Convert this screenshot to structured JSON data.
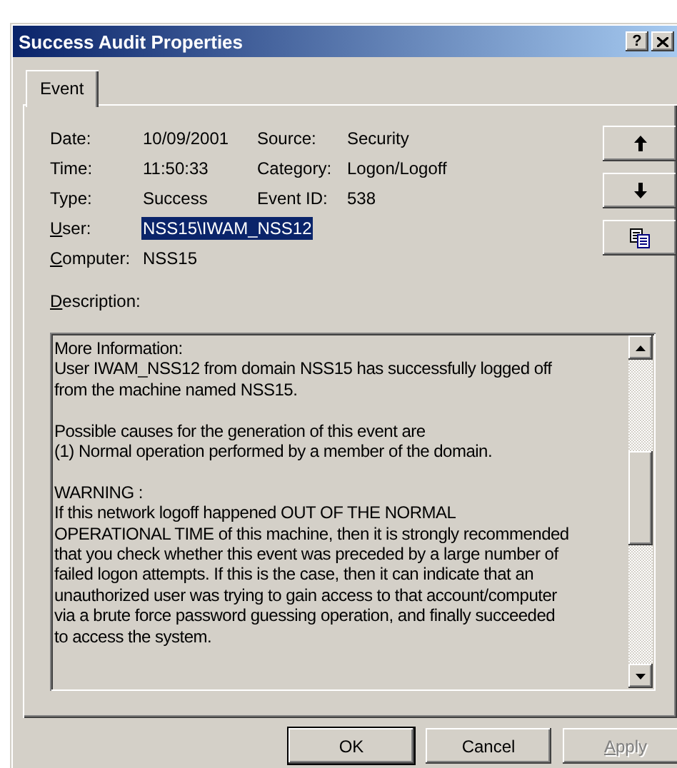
{
  "window": {
    "title": "Success Audit Properties",
    "title_buttons": [
      {
        "kind": "help",
        "label": "?"
      },
      {
        "kind": "close"
      }
    ]
  },
  "tabs": [
    {
      "label": "Event",
      "selected": true
    }
  ],
  "fields": [
    [
      {
        "label": "Date:",
        "value": "10/09/2001"
      },
      {
        "label": "Source:",
        "value": "Security"
      }
    ],
    [
      {
        "label": "Time:",
        "value": "11:50:33"
      },
      {
        "label": "Category:",
        "value": "Logon/Logoff"
      }
    ],
    [
      {
        "label": "Type:",
        "value": "Success"
      },
      {
        "label": "Event ID:",
        "value": "538"
      }
    ],
    [
      {
        "label": "User:",
        "mnemonic": true,
        "value": "NSS15\\IWAM_NSS12",
        "selected": true
      }
    ],
    [
      {
        "label": "Computer:",
        "mnemonic": true,
        "value": "NSS15",
        "selected": false
      }
    ]
  ],
  "nav_buttons": [
    {
      "kind": "up"
    },
    {
      "kind": "down"
    },
    {
      "kind": "copy"
    }
  ],
  "description": {
    "label": "Description:",
    "mnemonic": true,
    "text": "More Information:\nUser IWAM_NSS12 from domain NSS15 has successfully logged off\nfrom the machine named NSS15.\n\nPossible causes for the generation of this event are\n(1) Normal operation performed by a member of the domain.\n\nWARNING :\nIf this network logoff happened OUT OF THE NORMAL\nOPERATIONAL TIME of this machine, then it is strongly recommended\nthat you check whether this event was preceded by a large number of\nfailed logon attempts. If this is the case, then it can indicate that an\nunauthorized user was trying to gain access to that account/computer\nvia a brute force password guessing operation, and finally succeeded\nto access the system."
  },
  "buttons": [
    {
      "label": "OK",
      "default": true,
      "disabled": false
    },
    {
      "label": "Cancel",
      "default": false,
      "disabled": false
    },
    {
      "label": "Apply",
      "mnemonic": true,
      "default": false,
      "disabled": true
    }
  ]
}
